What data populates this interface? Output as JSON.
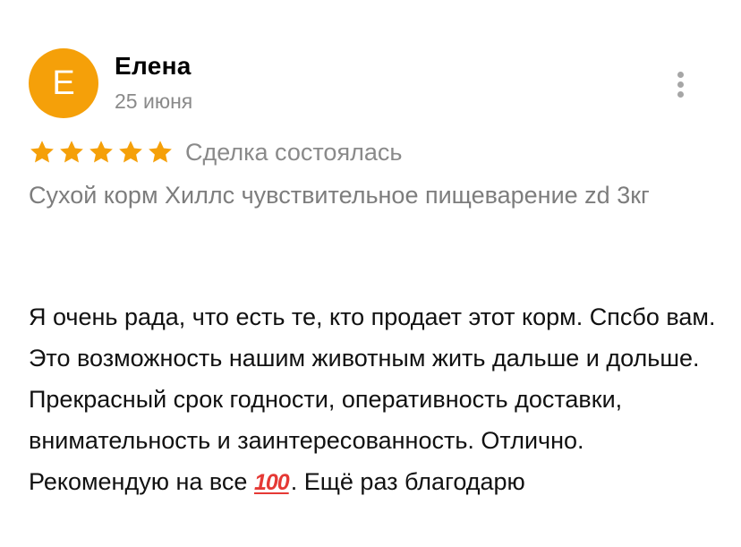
{
  "author": {
    "avatar_letter": "E",
    "avatar_color": "#f5a009",
    "name": "Елена",
    "date": "25 июня"
  },
  "rating": {
    "stars": 5,
    "max_stars": 5,
    "star_color": "#f5a009",
    "status": "Сделка состоялась"
  },
  "product": {
    "name": "Сухой корм Хиллс чувствительное пищеварение zd 3кг"
  },
  "review": {
    "text": "Я очень рада, что есть те, кто продает этот корм. Спсбо вам. Это возможность нашим животным жить дальше и дольше. Прекрасный срок годности, оперативность доставки, внимательность и заинтересованность. Отлично. Рекомендую на все",
    "emoji": "100",
    "emoji_icon": "hundred-points-icon",
    "text_end": ". Ещё раз благодарю"
  },
  "menu": {
    "icon": "more-vertical-icon"
  }
}
